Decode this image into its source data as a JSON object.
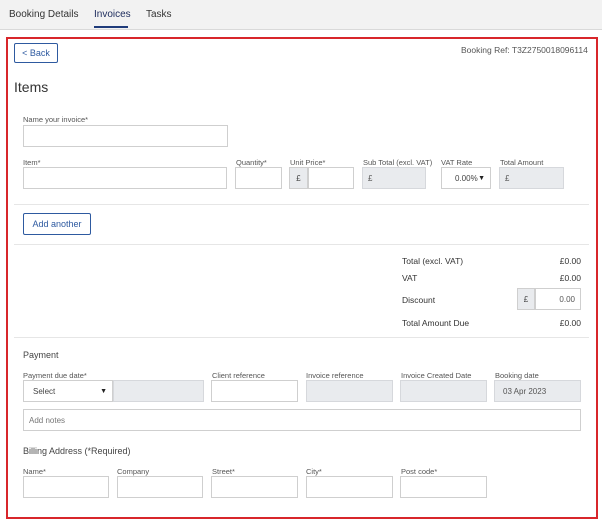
{
  "tabs": [
    {
      "label": "Booking Details",
      "active": false
    },
    {
      "label": "Invoices",
      "active": true
    },
    {
      "label": "Tasks",
      "active": false
    }
  ],
  "header": {
    "back_label": "< Back",
    "booking_ref": "Booking Ref: T3Z2750018096114",
    "title": "Items"
  },
  "invoice_name": {
    "label": "Name your invoice*",
    "value": ""
  },
  "item_row": {
    "item_label": "Item*",
    "quantity_label": "Quantity*",
    "unit_price_label": "Unit Price*",
    "subtotal_label": "Sub Total (excl. VAT)",
    "vat_rate_label": "VAT Rate",
    "total_amount_label": "Total Amount",
    "currency": "£",
    "vat_rate_value": "0.00%"
  },
  "add_another_label": "Add another",
  "totals": {
    "total_excl_label": "Total (excl. VAT)",
    "total_excl_value": "£0.00",
    "vat_label": "VAT",
    "vat_value": "£0.00",
    "discount_label": "Discount",
    "discount_currency": "£",
    "discount_value": "0.00",
    "total_due_label": "Total Amount Due",
    "total_due_value": "£0.00"
  },
  "payment": {
    "title": "Payment",
    "due_date_label": "Payment due date*",
    "due_date_select": "Select",
    "client_ref_label": "Client reference",
    "invoice_ref_label": "Invoice reference",
    "created_date_label": "Invoice Created Date",
    "booking_date_label": "Booking date",
    "booking_date_value": "03 Apr 2023",
    "notes_placeholder": "Add notes"
  },
  "billing": {
    "title": "Billing Address (*Required)",
    "name_label": "Name*",
    "company_label": "Company",
    "street_label": "Street*",
    "city_label": "City*",
    "postcode_label": "Post code*"
  },
  "colors": {
    "accent": "#2e5aa0",
    "frame": "#d8262b",
    "disabled": "#e9ebee"
  }
}
